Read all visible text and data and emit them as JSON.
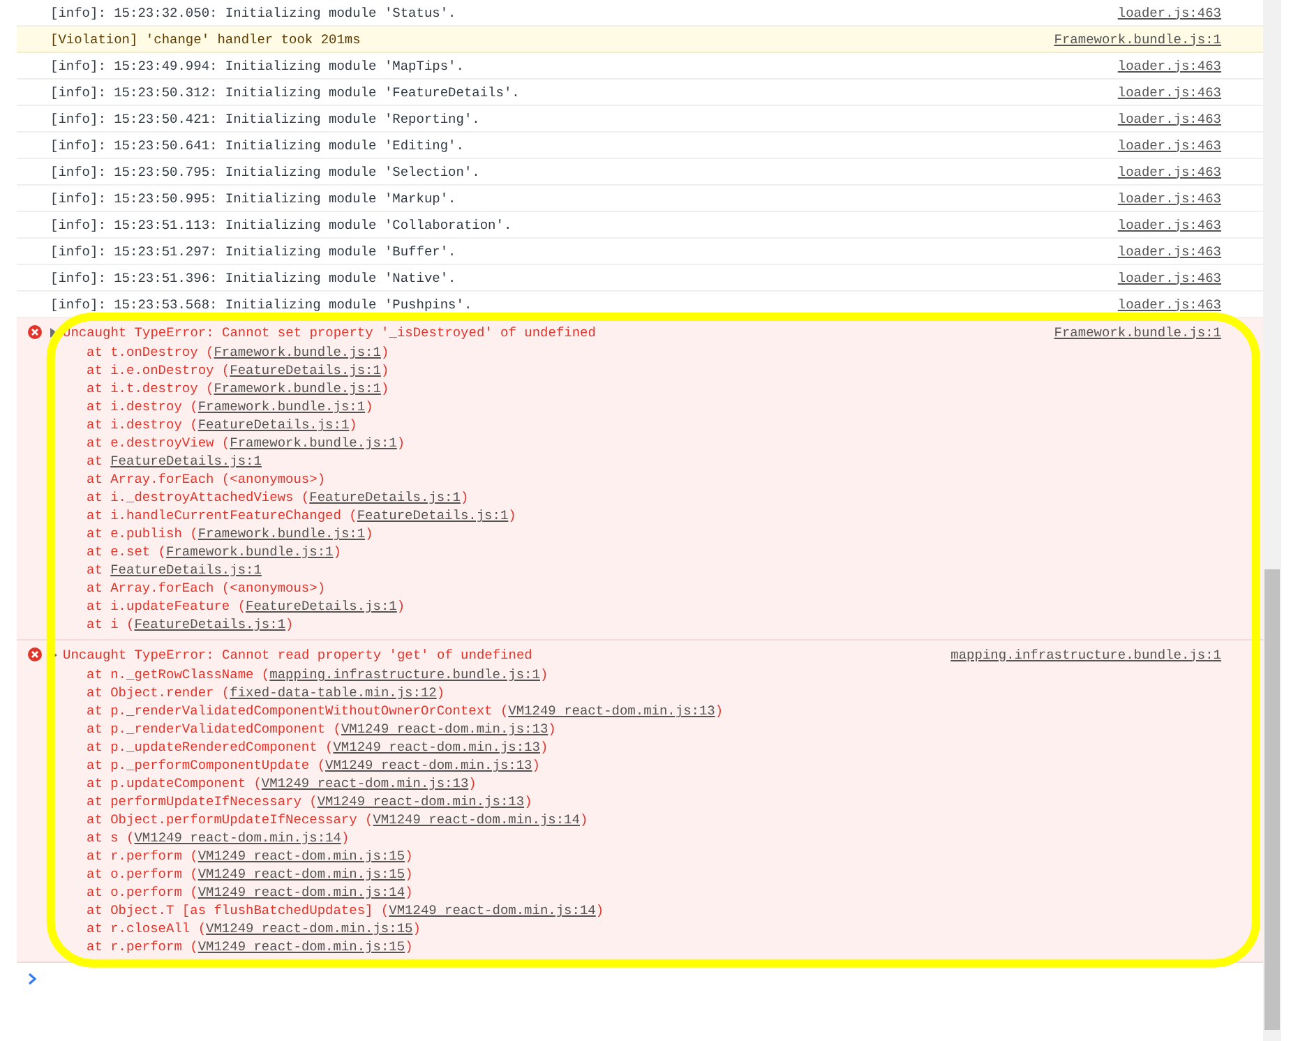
{
  "console": {
    "messages": [
      {
        "kind": "info",
        "text": "[info]: 15:23:32.050: Initializing module 'Status'.",
        "source": "loader.js:463"
      },
      {
        "kind": "violation",
        "text": "[Violation] 'change' handler took 201ms",
        "source": "Framework.bundle.js:1"
      },
      {
        "kind": "info",
        "text": "[info]: 15:23:49.994: Initializing module 'MapTips'.",
        "source": "loader.js:463"
      },
      {
        "kind": "info",
        "text": "[info]: 15:23:50.312: Initializing module 'FeatureDetails'.",
        "source": "loader.js:463"
      },
      {
        "kind": "info",
        "text": "[info]: 15:23:50.421: Initializing module 'Reporting'.",
        "source": "loader.js:463"
      },
      {
        "kind": "info",
        "text": "[info]: 15:23:50.641: Initializing module 'Editing'.",
        "source": "loader.js:463"
      },
      {
        "kind": "info",
        "text": "[info]: 15:23:50.795: Initializing module 'Selection'.",
        "source": "loader.js:463"
      },
      {
        "kind": "info",
        "text": "[info]: 15:23:50.995: Initializing module 'Markup'.",
        "source": "loader.js:463"
      },
      {
        "kind": "info",
        "text": "[info]: 15:23:51.113: Initializing module 'Collaboration'.",
        "source": "loader.js:463"
      },
      {
        "kind": "info",
        "text": "[info]: 15:23:51.297: Initializing module 'Buffer'.",
        "source": "loader.js:463"
      },
      {
        "kind": "info",
        "text": "[info]: 15:23:51.396: Initializing module 'Native'.",
        "source": "loader.js:463"
      },
      {
        "kind": "info",
        "text": "[info]: 15:23:53.568: Initializing module 'Pushpins'.",
        "source": "loader.js:463"
      },
      {
        "kind": "error",
        "text": "Uncaught TypeError: Cannot set property '_isDestroyed' of undefined",
        "source": "Framework.bundle.js:1",
        "stack": [
          {
            "prefix": "at t.onDestroy (",
            "link": "Framework.bundle.js:1",
            "suffix": ")"
          },
          {
            "prefix": "at i.e.onDestroy (",
            "link": "FeatureDetails.js:1",
            "suffix": ")"
          },
          {
            "prefix": "at i.t.destroy (",
            "link": "Framework.bundle.js:1",
            "suffix": ")"
          },
          {
            "prefix": "at i.destroy (",
            "link": "Framework.bundle.js:1",
            "suffix": ")"
          },
          {
            "prefix": "at i.destroy (",
            "link": "FeatureDetails.js:1",
            "suffix": ")"
          },
          {
            "prefix": "at e.destroyView (",
            "link": "Framework.bundle.js:1",
            "suffix": ")"
          },
          {
            "prefix": "at ",
            "link": "FeatureDetails.js:1"
          },
          {
            "prefix": "at Array.forEach (<anonymous>)"
          },
          {
            "prefix": "at i._destroyAttachedViews (",
            "link": "FeatureDetails.js:1",
            "suffix": ")"
          },
          {
            "prefix": "at i.handleCurrentFeatureChanged (",
            "link": "FeatureDetails.js:1",
            "suffix": ")"
          },
          {
            "prefix": "at e.publish (",
            "link": "Framework.bundle.js:1",
            "suffix": ")"
          },
          {
            "prefix": "at e.set (",
            "link": "Framework.bundle.js:1",
            "suffix": ")"
          },
          {
            "prefix": "at ",
            "link": "FeatureDetails.js:1"
          },
          {
            "prefix": "at Array.forEach (<anonymous>)"
          },
          {
            "prefix": "at i.updateFeature (",
            "link": "FeatureDetails.js:1",
            "suffix": ")"
          },
          {
            "prefix": "at i (",
            "link": "FeatureDetails.js:1",
            "suffix": ")"
          }
        ]
      },
      {
        "kind": "error",
        "text": "Uncaught TypeError: Cannot read property 'get' of undefined",
        "source": "mapping.infrastructure.bundle.js:1",
        "stack": [
          {
            "prefix": "at n._getRowClassName (",
            "link": "mapping.infrastructure.bundle.js:1",
            "suffix": ")"
          },
          {
            "prefix": "at Object.render (",
            "link": "fixed-data-table.min.js:12",
            "suffix": ")"
          },
          {
            "prefix": "at p._renderValidatedComponentWithoutOwnerOrContext (",
            "link": "VM1249 react-dom.min.js:13",
            "suffix": ")"
          },
          {
            "prefix": "at p._renderValidatedComponent (",
            "link": "VM1249 react-dom.min.js:13",
            "suffix": ")"
          },
          {
            "prefix": "at p._updateRenderedComponent (",
            "link": "VM1249 react-dom.min.js:13",
            "suffix": ")"
          },
          {
            "prefix": "at p._performComponentUpdate (",
            "link": "VM1249 react-dom.min.js:13",
            "suffix": ")"
          },
          {
            "prefix": "at p.updateComponent (",
            "link": "VM1249 react-dom.min.js:13",
            "suffix": ")"
          },
          {
            "prefix": "at performUpdateIfNecessary (",
            "link": "VM1249 react-dom.min.js:13",
            "suffix": ")"
          },
          {
            "prefix": "at Object.performUpdateIfNecessary (",
            "link": "VM1249 react-dom.min.js:14",
            "suffix": ")"
          },
          {
            "prefix": "at s (",
            "link": "VM1249 react-dom.min.js:14",
            "suffix": ")"
          },
          {
            "prefix": "at r.perform (",
            "link": "VM1249 react-dom.min.js:15",
            "suffix": ")"
          },
          {
            "prefix": "at o.perform (",
            "link": "VM1249 react-dom.min.js:15",
            "suffix": ")"
          },
          {
            "prefix": "at o.perform (",
            "link": "VM1249 react-dom.min.js:14",
            "suffix": ")"
          },
          {
            "prefix": "at Object.T [as flushBatchedUpdates] (",
            "link": "VM1249 react-dom.min.js:14",
            "suffix": ")"
          },
          {
            "prefix": "at r.closeAll (",
            "link": "VM1249 react-dom.min.js:15",
            "suffix": ")"
          },
          {
            "prefix": "at r.perform (",
            "link": "VM1249 react-dom.min.js:15",
            "suffix": ")"
          }
        ]
      }
    ]
  }
}
